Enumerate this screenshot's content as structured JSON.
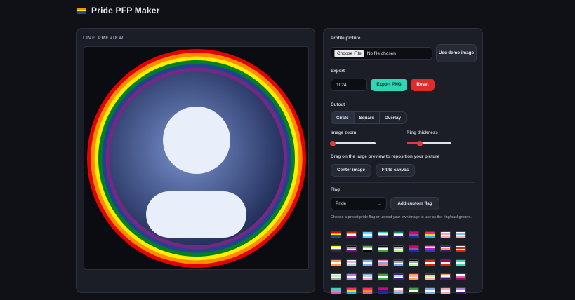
{
  "app": {
    "title": "Pride PFP Maker",
    "logo_colors": [
      "#e40303",
      "#ff8c00",
      "#ffed00",
      "#008026",
      "#24408e",
      "#732982"
    ]
  },
  "preview": {
    "label": "LIVE PREVIEW",
    "ring_colors": [
      "#e40303",
      "#ff8c00",
      "#ffed00",
      "#008026",
      "#24408e",
      "#732982"
    ],
    "avatar_colors": {
      "bg_center": "#7a93d0",
      "bg_edge": "#1e2a55",
      "silhouette": "#e8effa"
    }
  },
  "controls": {
    "profile_picture": {
      "label": "Profile picture",
      "choose_file": "Choose File",
      "file_status": "No file chosen",
      "demo_button": "Use demo image"
    },
    "export": {
      "label": "Export",
      "size_value": "1024",
      "export_button": "Export PNG",
      "reset_button": "Reset"
    },
    "cutout": {
      "label": "Cutout",
      "options": [
        "Circle",
        "Square",
        "Overlay"
      ],
      "selected": "Circle"
    },
    "sliders": {
      "zoom_label": "Image zoom",
      "zoom_value": 0.05,
      "thickness_label": "Ring thickness",
      "thickness_value": 0.3
    },
    "reposition": {
      "hint": "Drag on the large preview to reposition your picture",
      "center_button": "Center image",
      "fit_button": "Fit to canvas"
    },
    "flag": {
      "label": "Flag",
      "selected": "Pride",
      "add_button": "Add custom flag",
      "help": "Choose a preset pride flag or upload your own image to use as the ring/background."
    }
  },
  "accent": {
    "export": "#2fd6b6",
    "reset": "#e02b2b",
    "slider": "#e23b3b"
  },
  "flag_swatches": [
    [
      "#e40303",
      "#ff8c00",
      "#ffed00",
      "#008026",
      "#24408e",
      "#732982"
    ],
    [
      "#d52d00",
      "#ff9a56",
      "#ffffff",
      "#d362a4",
      "#a30262"
    ],
    [
      "#5bcefa",
      "#f5a9b8",
      "#ffffff",
      "#f5a9b8",
      "#5bcefa"
    ],
    [
      "#3dd6a8",
      "#ffffff",
      "#7bade2",
      "#3d1a78"
    ],
    [
      "#078d70",
      "#98e8c1",
      "#ffffff",
      "#7bade2",
      "#3d1a78"
    ],
    [
      "#d60270",
      "#9b4f96",
      "#0038a8"
    ],
    [
      "#ff218c",
      "#ffd800",
      "#21b1ff"
    ],
    [
      "#ffffff",
      "#f5a9b8",
      "#ffffff",
      "#f5a9b8"
    ],
    [
      "#ffffff",
      "#5bcefa",
      "#ffffff",
      "#f5a9b8"
    ],
    [
      "#fcf434",
      "#ffffff",
      "#9c59d1",
      "#2c2c2c"
    ],
    [
      "#000000",
      "#a3a3a3",
      "#ffffff",
      "#800080"
    ],
    [
      "#3da542",
      "#a7d379",
      "#ffffff",
      "#a9a9a9",
      "#000000"
    ],
    [
      "#000000",
      "#a4a4a4",
      "#ffffff",
      "#b6f5b1",
      "#3da542"
    ],
    [
      "#000000",
      "#b9b9b9",
      "#ffffff",
      "#b8f483"
    ],
    [
      "#d60270",
      "#d60270",
      "#9b4f96",
      "#0038a8",
      "#0038a8"
    ],
    [
      "#ff76a4",
      "#ffffff",
      "#c011d7",
      "#000000",
      "#2f3cbe"
    ],
    [
      "#3d1a78",
      "#ffffff",
      "#ff9a56",
      "#ffffff",
      "#3d1a78"
    ],
    [
      "#ffffff",
      "#d72800",
      "#ffffff",
      "#d72800"
    ],
    [
      "#ff9a56",
      "#ffffff",
      "#ff9a56"
    ],
    [
      "#ffffff",
      "#e0b7d3",
      "#ffffff",
      "#b6d4e3"
    ],
    [
      "#7bade2",
      "#ffffff",
      "#7bade2"
    ],
    [
      "#fe76a2",
      "#ffffff",
      "#7bade2",
      "#ffffff",
      "#fe76a2"
    ],
    [
      "#2c2c2c",
      "#a3a3a3",
      "#ffffff",
      "#7bade2"
    ],
    [
      "#000000",
      "#a3a3a3",
      "#ffffff",
      "#b6f5b1"
    ],
    [
      "#d72800",
      "#ffffff",
      "#d72800"
    ],
    [
      "#a30262",
      "#ffffff",
      "#d52d00"
    ],
    [
      "#3dd6a8",
      "#ffffff",
      "#3dd6a8"
    ],
    [
      "#ffffff",
      "#b6f5b1",
      "#ffffff",
      "#a3a3a3"
    ],
    [
      "#b57edc",
      "#ffffff",
      "#b57edc"
    ],
    [
      "#7bade2",
      "#b6d4e3",
      "#ffffff",
      "#f5a9b8"
    ],
    [
      "#3da542",
      "#ffffff",
      "#3da542"
    ],
    [
      "#3d1a78",
      "#b6d4e3",
      "#ffffff",
      "#3d1a78"
    ],
    [
      "#ff9a56",
      "#f5a9b8",
      "#ffffff",
      "#ff9a56"
    ],
    [
      "#2c2c2c",
      "#b8f483",
      "#ffffff",
      "#f5a9b8"
    ],
    [
      "#ff9a56",
      "#ffffff",
      "#7bade2",
      "#3d1a78"
    ],
    [
      "#ffffff",
      "#d362a4",
      "#a30262"
    ],
    [
      "#3dd6a8",
      "#7bade2",
      "#d362a4"
    ],
    [
      "#ff218c",
      "#ffd800",
      "#21b1ff"
    ],
    [
      "#ff218c",
      "#ff8c00",
      "#d362a4"
    ],
    [
      "#d60270",
      "#3d1a78",
      "#0038a8"
    ],
    [
      "#ffffff",
      "#f5a9b8",
      "#7bade2"
    ],
    [
      "#3da542",
      "#ffffff",
      "#2c2c2c"
    ],
    [
      "#7bade2",
      "#ffffff",
      "#7bade2"
    ],
    [
      "#f5a9b8",
      "#ffffff",
      "#f5a9b8"
    ],
    [
      "#b57edc",
      "#ffffff",
      "#3d1a78"
    ],
    [
      "#ff8c00",
      "#d362a4",
      "#732982"
    ],
    [
      "#a8d4ff",
      "#ffffff",
      "#a8d4ff"
    ]
  ]
}
